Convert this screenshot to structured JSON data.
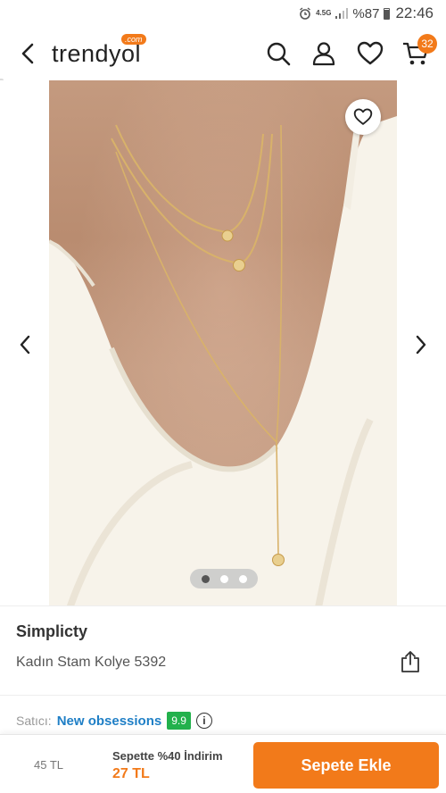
{
  "status_bar": {
    "network": "4.5G",
    "battery": "%87",
    "time": "22:46"
  },
  "header": {
    "logo_text": "trendyol",
    "logo_badge": ".com",
    "cart_count": "32"
  },
  "gallery": {
    "slide_count": 3,
    "active_slide": 1
  },
  "product": {
    "brand": "Simplicty",
    "name": "Kadın Stam Kolye 5392"
  },
  "seller": {
    "label": "Satıcı:",
    "name": "New obsessions",
    "score": "9.9",
    "info_symbol": "i"
  },
  "bottom_bar": {
    "old_price": "45 TL",
    "discount_label": "Sepette %40 İndirim",
    "new_price": "27 TL",
    "add_to_cart_label": "Sepete Ekle"
  },
  "colors": {
    "accent": "#f27a1a",
    "seller_link": "#1f7fc6",
    "score_badge": "#22b14c"
  }
}
